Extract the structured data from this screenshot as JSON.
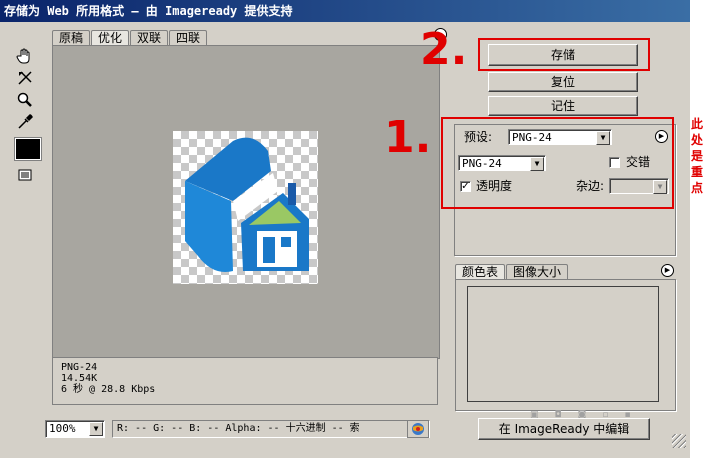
{
  "window": {
    "title": "存储为 Web 所用格式 — 由 Imageready 提供支持"
  },
  "tabs": [
    "原稿",
    "优化",
    "双联",
    "四联"
  ],
  "active_tab": "优化",
  "preview": {
    "format": "PNG-24",
    "size": "14.54K",
    "time": "6 秒 @ 28.8 Kbps"
  },
  "buttons": {
    "save": "存储",
    "reset": "复位",
    "remember": "记住",
    "edit_in_imageready": "在 ImageReady 中编辑"
  },
  "settings": {
    "preset_label": "预设:",
    "preset_value": "PNG-24",
    "format_value": "PNG-24",
    "interlaced_label": "交错",
    "interlaced_checked": false,
    "transparency_label": "透明度",
    "transparency_checked": true,
    "matte_label": "杂边:",
    "matte_value": ""
  },
  "panel_tabs": [
    "颜色表",
    "图像大小"
  ],
  "status_bar": {
    "zoom": "100%",
    "readout": "R:  -- G:   -- B:   -- Alpha:   -- 十六进制 -- 索"
  },
  "annotations": {
    "step1": "1.",
    "step2": "2.",
    "note_chars": [
      "此",
      "处",
      "是",
      "重",
      "点"
    ]
  },
  "colors": {
    "annotation_red": "#e00000",
    "logo_blue": "#1a78c8",
    "logo_green": "#9ac864"
  }
}
